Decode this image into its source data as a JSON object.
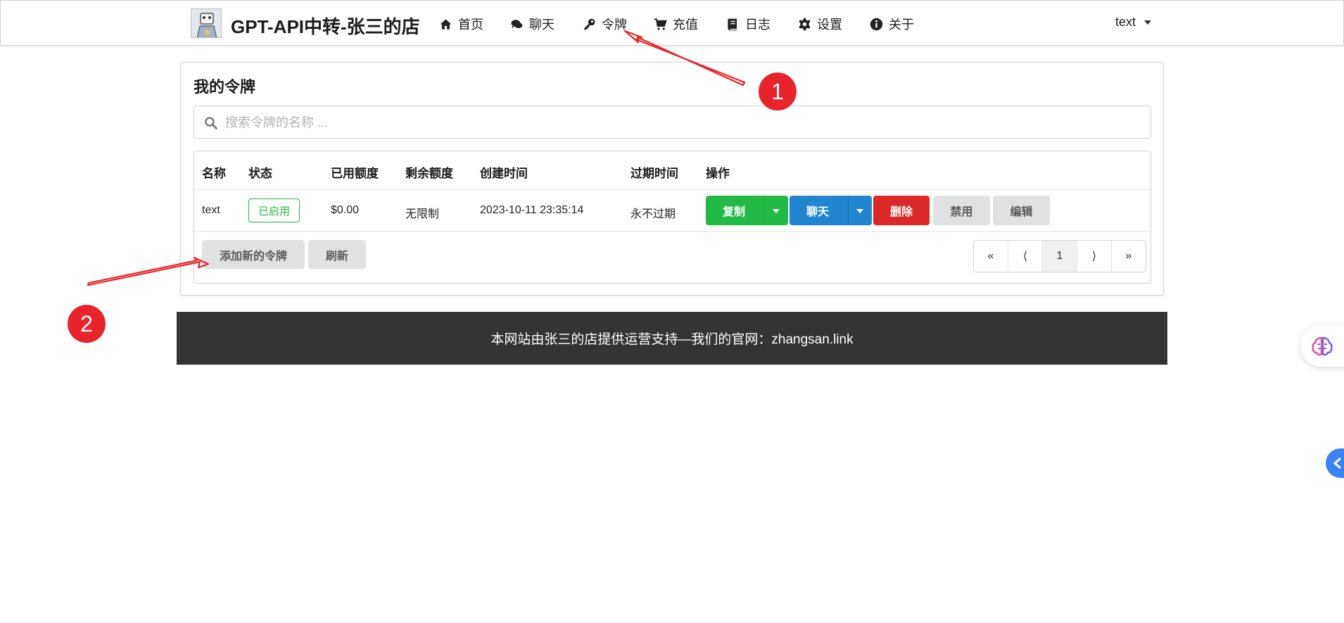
{
  "app": {
    "brand": "GPT-API中转-张三的店",
    "logo_icon": "robot-avatar-icon"
  },
  "nav": {
    "items": [
      {
        "label": "首页",
        "icon": "home-icon"
      },
      {
        "label": "聊天",
        "icon": "chat-icon"
      },
      {
        "label": "令牌",
        "icon": "key-icon"
      },
      {
        "label": "充值",
        "icon": "cart-icon"
      },
      {
        "label": "日志",
        "icon": "book-icon"
      },
      {
        "label": "设置",
        "icon": "gear-icon"
      },
      {
        "label": "关于",
        "icon": "info-icon"
      }
    ],
    "user": "text"
  },
  "tokens": {
    "title": "我的令牌",
    "search_placeholder": "搜索令牌的名称 ...",
    "columns": [
      "名称",
      "状态",
      "已用额度",
      "剩余额度",
      "创建时间",
      "过期时间",
      "操作"
    ],
    "rows": [
      {
        "name": "text",
        "status": "已启用",
        "used": "$0.00",
        "remaining": "无限制",
        "created": "2023-10-11 23:35:14",
        "expires": "永不过期"
      }
    ],
    "actions": {
      "copy": "复制",
      "chat": "聊天",
      "delete": "删除",
      "disable": "禁用",
      "edit": "编辑"
    },
    "add_button": "添加新的令牌",
    "refresh_button": "刷新",
    "pagination": {
      "first": "«",
      "prev": "⟨",
      "current": "1",
      "next": "⟩",
      "last": "»"
    }
  },
  "footer": {
    "text": "本网站由张三的店提供运营支持—我们的官网：zhangsan.link"
  },
  "annotations": {
    "step1": "1",
    "step2": "2",
    "color": "#e8242b"
  },
  "colors": {
    "green": "#21ba45",
    "blue": "#2185d0",
    "red": "#db2828",
    "footer_bg": "#343434"
  }
}
